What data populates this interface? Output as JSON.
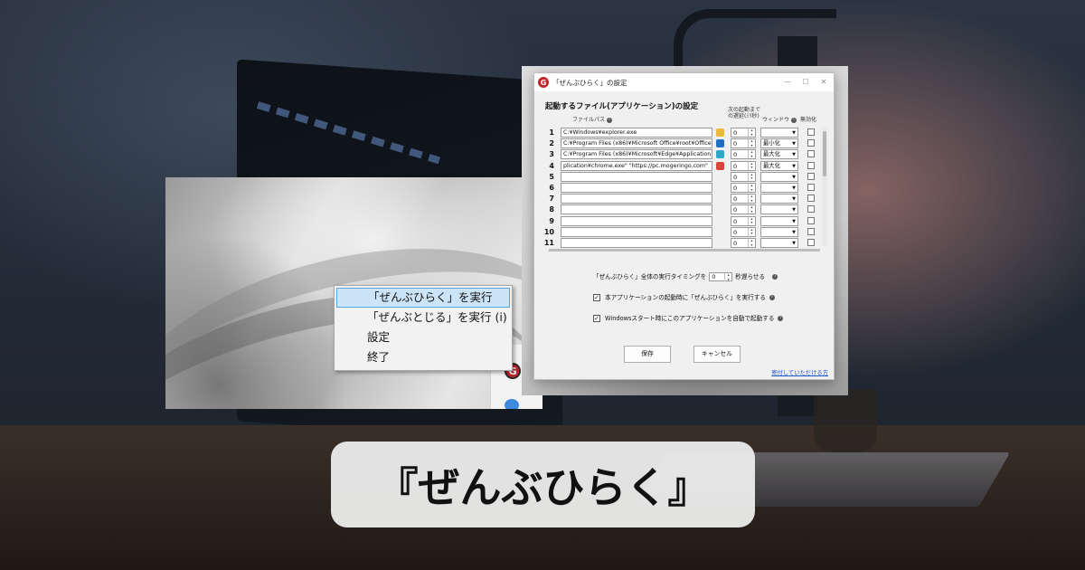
{
  "caption": "『ぜんぶひらく』",
  "desktop": {
    "tray_icon_glyph": "G",
    "context_menu": {
      "items": [
        {
          "label": "「ぜんぶひらく」を実行",
          "highlighted": true
        },
        {
          "label": "「ぜんぶとじる」を実行 (i)",
          "highlighted": false
        },
        {
          "label": "設定",
          "highlighted": false
        },
        {
          "label": "終了",
          "highlighted": false
        }
      ]
    }
  },
  "settings_window": {
    "title": "「ぜんぶひらく」の設定",
    "app_icon_glyph": "G",
    "title_buttons": {
      "minimize": "—",
      "maximize": "☐",
      "close": "✕"
    },
    "section_heading": "起動するファイル(アプリケーション)の設定",
    "columns": {
      "file_path": "ファイルパス",
      "delay_line1": "次の起動まで",
      "delay_line2": "の遅延(ﾐﾘ秒)",
      "window": "ウィンドウ",
      "disable": "無効化"
    },
    "rows": [
      {
        "num": "1",
        "path": "C:¥Windows¥explorer.exe",
        "delay": "0",
        "window": "",
        "icon": "folder-icon",
        "icon_color": "#e9b93c"
      },
      {
        "num": "2",
        "path": "C:¥Program Files (x86)¥Microsoft Office¥root¥Office",
        "delay": "0",
        "window": "最小化",
        "icon": "outlook-icon",
        "icon_color": "#1f6fc5"
      },
      {
        "num": "3",
        "path": "C:¥Program Files (x86)¥Microsoft¥Edge¥Application",
        "delay": "0",
        "window": "最大化",
        "icon": "edge-icon",
        "icon_color": "#2fa7c9"
      },
      {
        "num": "4",
        "path": "plication¥chrome.exe\" \"https://pc.mogeringo.com\"",
        "delay": "0",
        "window": "最大化",
        "icon": "chrome-icon",
        "icon_color": "#d9463b"
      },
      {
        "num": "5",
        "path": "",
        "delay": "0",
        "window": "",
        "icon": "",
        "icon_color": ""
      },
      {
        "num": "6",
        "path": "",
        "delay": "0",
        "window": "",
        "icon": "",
        "icon_color": ""
      },
      {
        "num": "7",
        "path": "",
        "delay": "0",
        "window": "",
        "icon": "",
        "icon_color": ""
      },
      {
        "num": "8",
        "path": "",
        "delay": "0",
        "window": "",
        "icon": "",
        "icon_color": ""
      },
      {
        "num": "9",
        "path": "",
        "delay": "0",
        "window": "",
        "icon": "",
        "icon_color": ""
      },
      {
        "num": "10",
        "path": "",
        "delay": "0",
        "window": "",
        "icon": "",
        "icon_color": ""
      },
      {
        "num": "11",
        "path": "",
        "delay": "0",
        "window": "",
        "icon": "",
        "icon_color": ""
      }
    ],
    "timing": {
      "prefix": "「ぜんぶひらく」全体の実行タイミングを",
      "value": "0",
      "suffix": "秒遅らせる"
    },
    "option_run_on_start": {
      "label": "本アプリケーションの起動時に「ぜんぶひらく」を実行する",
      "checked": true
    },
    "option_autostart": {
      "label": "Windowsスタート時にこのアプリケーションを自動で起動する",
      "checked": true
    },
    "save_label": "保存",
    "cancel_label": "キャンセル",
    "donate_link": "寄付していただける方"
  },
  "colors": {
    "app_icon": "#c0262b",
    "menu_highlight": "#cce4f7",
    "link": "#1a55c8"
  }
}
